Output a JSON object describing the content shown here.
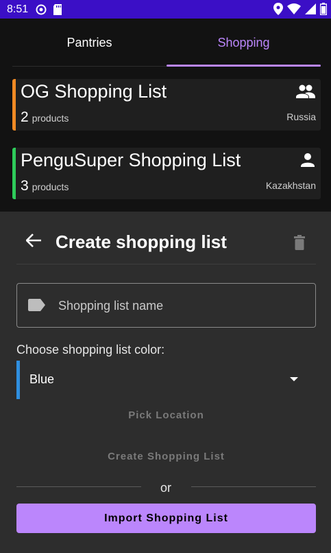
{
  "status_bar": {
    "time": "8:51",
    "left_icons": [
      "at-sign-icon",
      "sd-card-icon"
    ],
    "right_icons": [
      "location-icon",
      "wifi-icon",
      "signal-icon",
      "battery-icon"
    ],
    "background": "#3b0fc6"
  },
  "tabs": [
    {
      "label": "Pantries",
      "active": false
    },
    {
      "label": "Shopping",
      "active": true
    }
  ],
  "accent_color": "#bb86fc",
  "shopping_lists": [
    {
      "title": "OG Shopping List",
      "count": "2",
      "count_label": "products",
      "country": "Russia",
      "color": "#f08a24",
      "icon": "group-icon"
    },
    {
      "title": "PenguSuper Shopping List",
      "count": "3",
      "count_label": "products",
      "country": "Kazakhstan",
      "color": "#2ecc5a",
      "icon": "person-icon"
    }
  ],
  "sheet": {
    "title": "Create shopping list",
    "name_placeholder": "Shopping list name",
    "color_label": "Choose shopping list color:",
    "color_value": "Blue",
    "color_hex": "#2f8fe0",
    "pick_location_label": "Pick Location",
    "create_label": "Create Shopping List",
    "or_label": "or",
    "import_label": "Import Shopping List"
  }
}
